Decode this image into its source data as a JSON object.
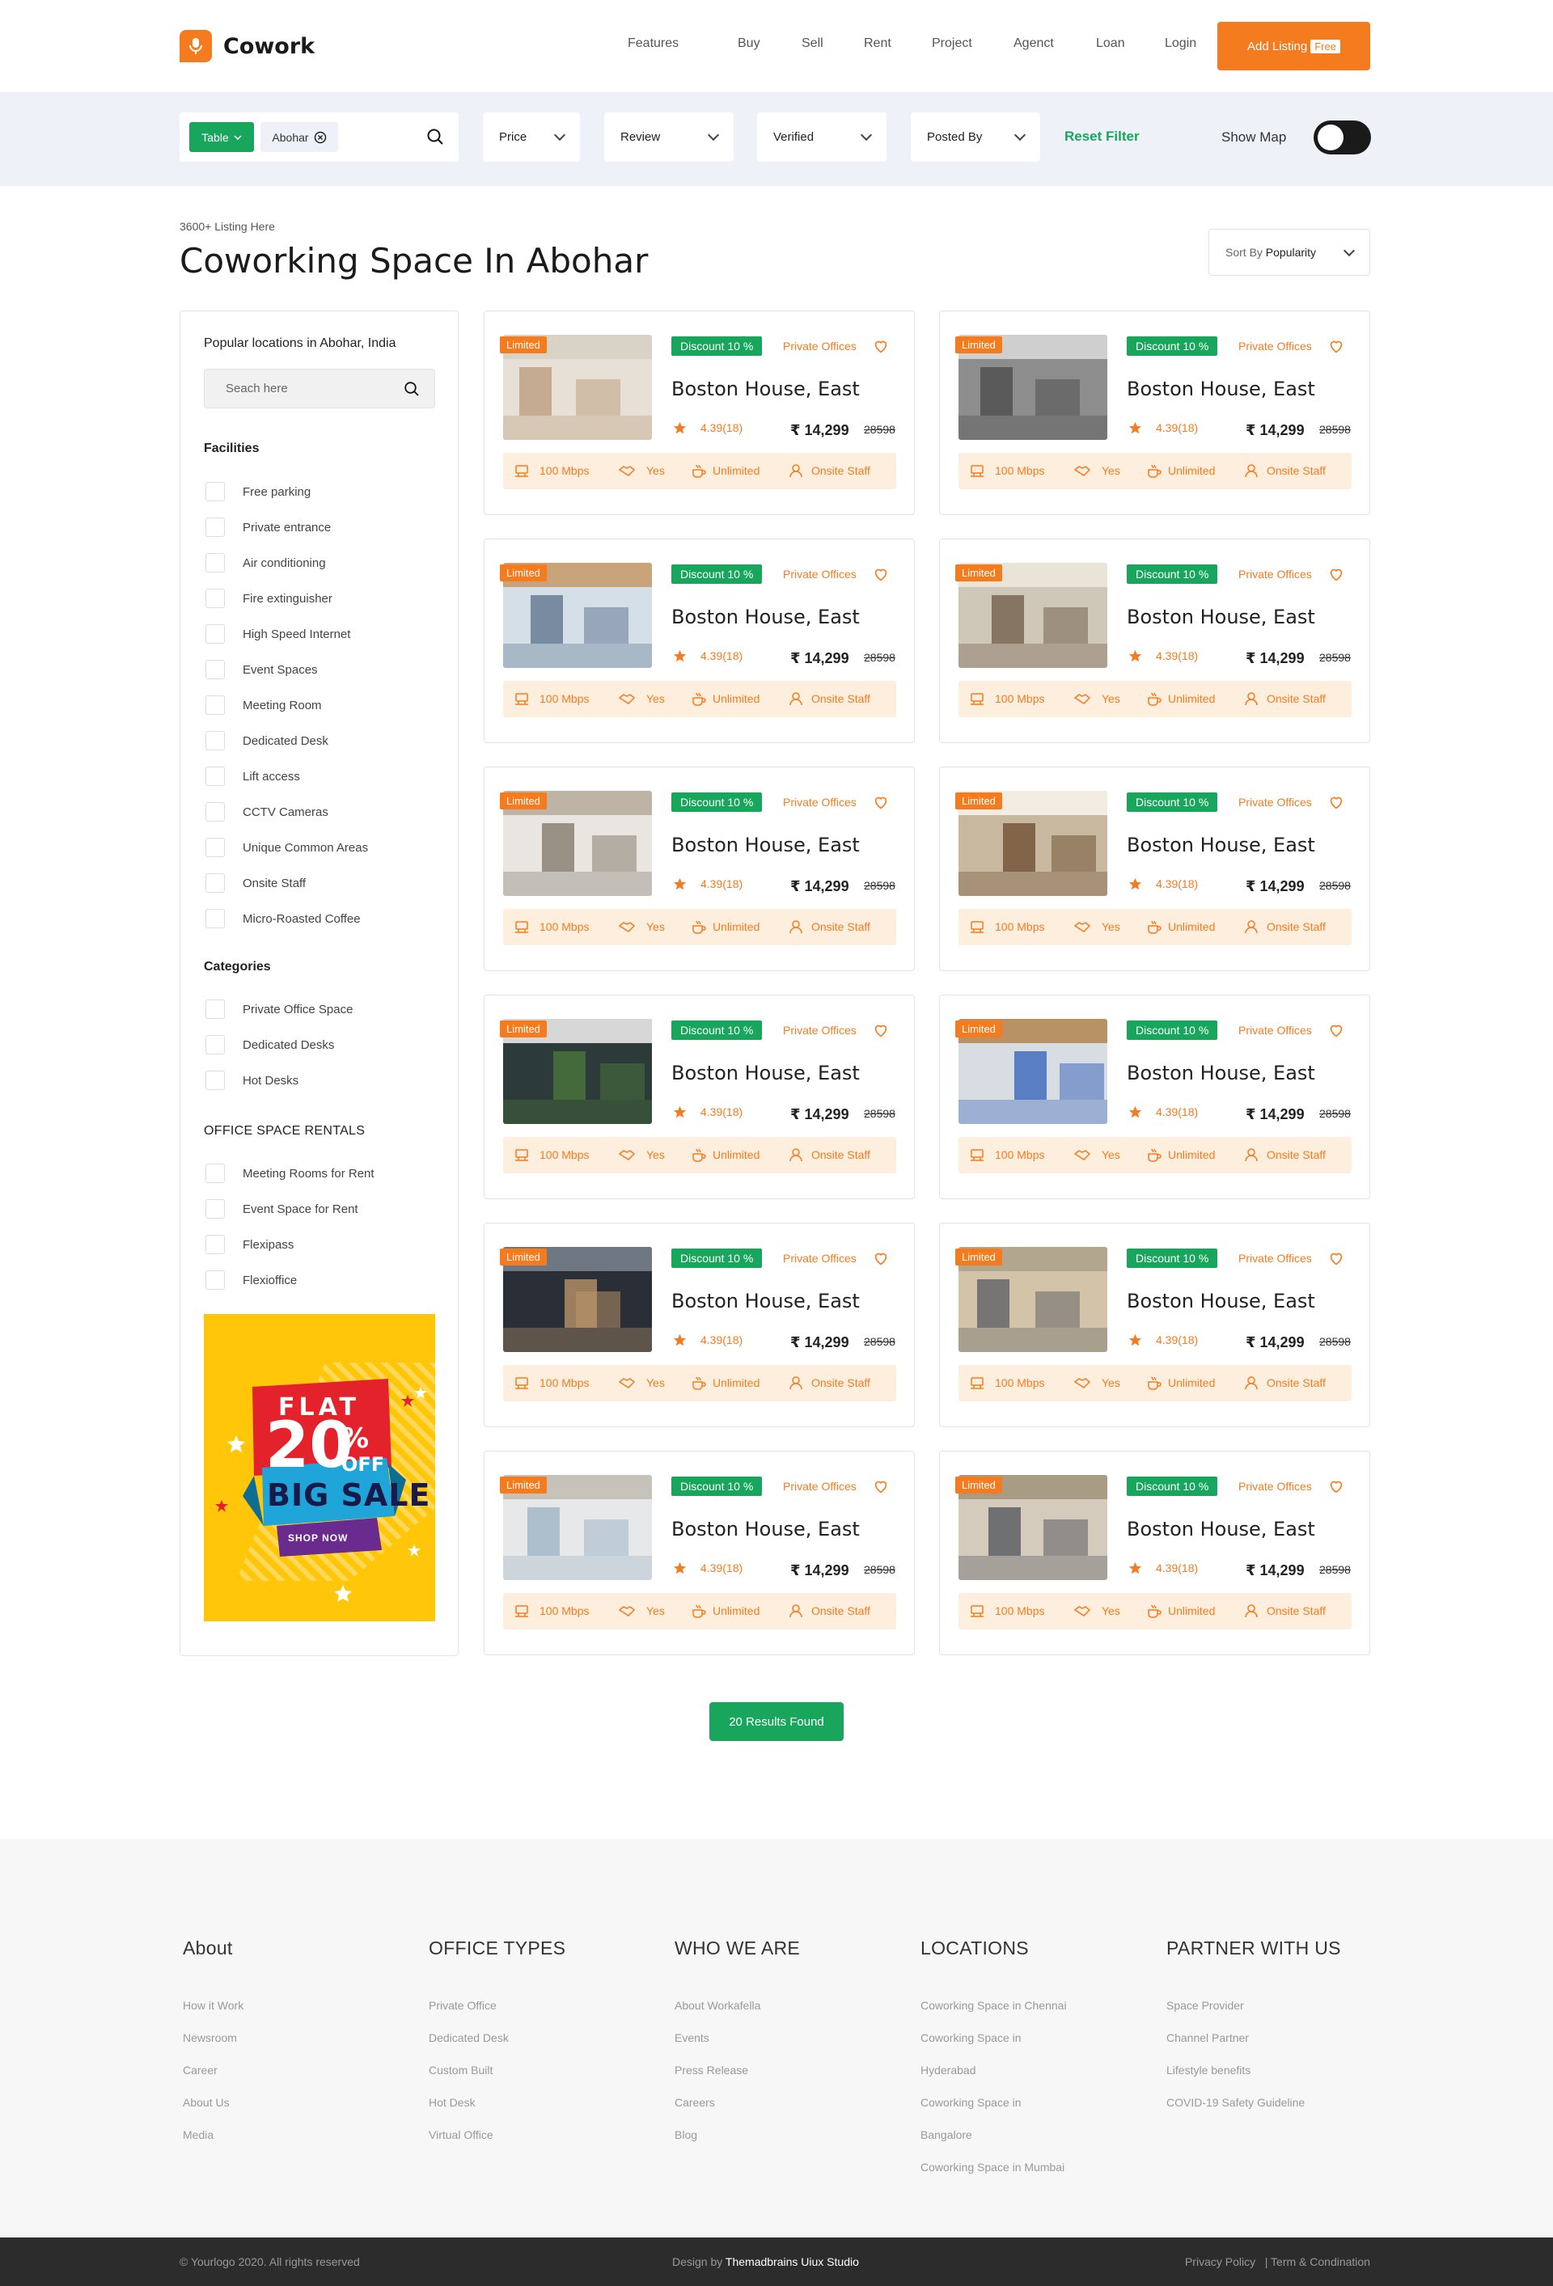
{
  "header": {
    "brand": "Cowork",
    "nav": [
      "Features",
      "Buy",
      "Sell",
      "Rent",
      "Project",
      "Agenct",
      "Loan",
      "Login"
    ],
    "cta_label": "Add Listing",
    "cta_badge": "Free"
  },
  "filters": {
    "type_chip": "Table",
    "city_chip": "Abohar",
    "price": "Price",
    "review": "Review",
    "verified": "Verified",
    "posted_by": "Posted By",
    "reset": "Reset Filter",
    "show_map": "Show Map",
    "show_map_on": true
  },
  "page": {
    "listing_count": "3600+ Listing Here",
    "title": "Coworking Space In Abohar",
    "sort_prefix": "Sort By",
    "sort_value": "Popularity"
  },
  "sidebar": {
    "title": "Popular locations in Abohar, India",
    "search_placeholder": "Seach here",
    "facilities_heading": "Facilities",
    "facilities": [
      "Free parking",
      "Private entrance",
      "Air conditioning",
      "Fire extinguisher",
      "High Speed Internet",
      "Event Spaces",
      "Meeting Room",
      "Dedicated Desk",
      "Lift access",
      "CCTV Cameras",
      "Unique Common Areas",
      "Onsite Staff",
      "Micro-Roasted Coffee"
    ],
    "categories_heading": "Categories",
    "categories": [
      "Private Office Space",
      "Dedicated Desks",
      "Hot Desks"
    ],
    "rentals_heading": "OFFICE SPACE RENTALS",
    "rentals": [
      "Meeting Rooms for Rent",
      "Event Space for Rent",
      "Flexipass",
      "Flexioffice"
    ],
    "promo": {
      "flat": "FLAT",
      "percent": "20",
      "pct_sign": "%",
      "off": "OFF",
      "big_sale": "BIG SALE",
      "shop_now": "SHOP NOW"
    }
  },
  "card": {
    "limited": "Limited",
    "discount": "Discount 10 %",
    "type": "Private Offices",
    "name": "Boston House, East",
    "rating": "4.39(18)",
    "price": "₹ 14,299",
    "old_price": "28598",
    "f1": "100 Mbps",
    "f2": "Yes",
    "f3": "Unlimited",
    "f4": "Onsite Staff"
  },
  "results_label": "20 Results Found",
  "footer": {
    "columns": [
      {
        "heading": "About",
        "links": [
          "How it Work",
          "Newsroom",
          "Career",
          "About Us",
          "Media"
        ]
      },
      {
        "heading": "OFFICE TYPES",
        "links": [
          "Private Office",
          "Dedicated Desk",
          "Custom Built",
          "Hot Desk",
          "Virtual Office"
        ]
      },
      {
        "heading": "WHO WE ARE",
        "links": [
          "About Workafella",
          "Events",
          "Press Release",
          "Careers",
          "Blog"
        ]
      },
      {
        "heading": "LOCATIONS",
        "links": [
          "Coworking Space in Chennai",
          "Coworking Space in",
          "Hyderabad",
          "Coworking Space in",
          "Bangalore",
          "Coworking Space in Mumbai"
        ]
      },
      {
        "heading": "PARTNER WITH US",
        "links": [
          "Space Provider",
          "Channel Partner",
          "Lifestyle benefits",
          "COVID-19 Safety Guideline"
        ]
      }
    ],
    "copyright": "© Yourlogo 2020. All rights reserved",
    "design_prefix": "Design by",
    "design_studio": "Themadbrains Uiux Studio",
    "privacy": "Privacy Policy",
    "terms": "| Term & Condination"
  },
  "colors": {
    "accent": "#f47c1f",
    "green": "#18a65d",
    "filterbar": "#eef1f8",
    "promo_yellow": "#ffc60a"
  }
}
